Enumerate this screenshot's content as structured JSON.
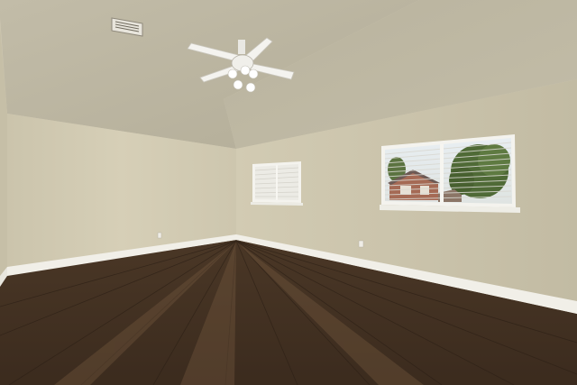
{
  "scene": {
    "colors": {
      "ceiling_left": "#bdb7a3",
      "ceiling_right": "#b4ae99",
      "wall_left": "#cfc8b0",
      "wall_back": "#d2cbb3",
      "wall_right": "#c9c2aa",
      "baseboard": "#f2f0ea",
      "floor_dark": "#3a2a1d",
      "floor_mid": "#5a4330",
      "floor_light": "#7a5f45",
      "window_frame": "#f4f3ee",
      "blinds": "#e9e8e2",
      "vent": "#9a9484",
      "fan_white": "#f3f2ee"
    }
  }
}
